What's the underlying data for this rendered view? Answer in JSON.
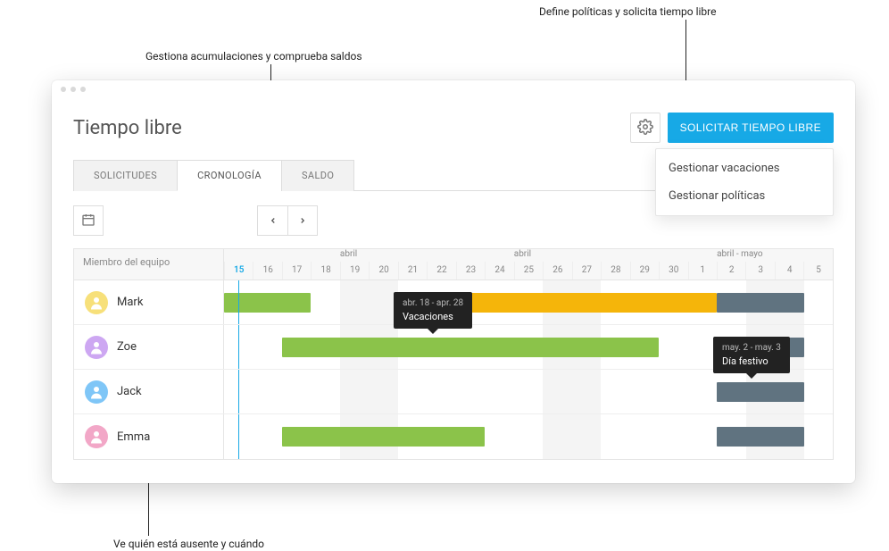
{
  "callouts": {
    "top_right": "Define políticas y solicita tiempo libre",
    "top_mid": "Gestiona acumulaciones y comprueba saldos",
    "bottom": "Ve quién está ausente y cuándo"
  },
  "header": {
    "title": "Tiempo libre",
    "request_button": "SOLICITAR TIEMPO LIBRE",
    "menu": {
      "manage_vacations": "Gestionar vacaciones",
      "manage_policies": "Gestionar políticas"
    }
  },
  "tabs": {
    "requests": "SOLICITUDES",
    "timeline": "CRONOLOGÍA",
    "balance": "SALDO"
  },
  "timeline": {
    "member_header": "Miembro del equipo",
    "month_groups": [
      {
        "label": "abril",
        "start_index": 4
      },
      {
        "label": "abril",
        "start_index": 10
      },
      {
        "label": "abril - mayo",
        "start_index": 17
      }
    ],
    "days": [
      15,
      16,
      17,
      18,
      19,
      20,
      21,
      22,
      23,
      24,
      25,
      26,
      27,
      28,
      29,
      30,
      1,
      2,
      3,
      4,
      5
    ],
    "today_index": 0,
    "stripe_ranges": [
      [
        4,
        5
      ],
      [
        11,
        12
      ],
      [
        18,
        19
      ]
    ],
    "members": [
      {
        "name": "Mark",
        "avatar_bg": "#f7e07a",
        "bars": [
          {
            "color": "green",
            "start": 0,
            "end": 2
          },
          {
            "color": "yellow",
            "start": 8,
            "end": 16
          },
          {
            "color": "slate",
            "start": 17,
            "end": 19
          }
        ]
      },
      {
        "name": "Zoe",
        "avatar_bg": "#cda7f2",
        "bars": [
          {
            "color": "green",
            "start": 2,
            "end": 14
          },
          {
            "color": "slate",
            "start": 17,
            "end": 19
          }
        ]
      },
      {
        "name": "Jack",
        "avatar_bg": "#7fc6f7",
        "bars": [
          {
            "color": "slate",
            "start": 17,
            "end": 19
          }
        ]
      },
      {
        "name": "Emma",
        "avatar_bg": "#f2a7c7",
        "bars": [
          {
            "color": "green",
            "start": 2,
            "end": 8
          },
          {
            "color": "slate",
            "start": 17,
            "end": 19
          }
        ]
      }
    ]
  },
  "tooltips": {
    "vac": {
      "dates": "abr. 18 - apr. 28",
      "label": "Vacaciones"
    },
    "hol": {
      "dates": "may. 2 - may. 3",
      "label": "Día festivo"
    }
  },
  "icons": {
    "gear": "gear-icon",
    "calendar": "calendar-icon",
    "prev": "chevron-left-icon",
    "next": "chevron-right-icon"
  }
}
